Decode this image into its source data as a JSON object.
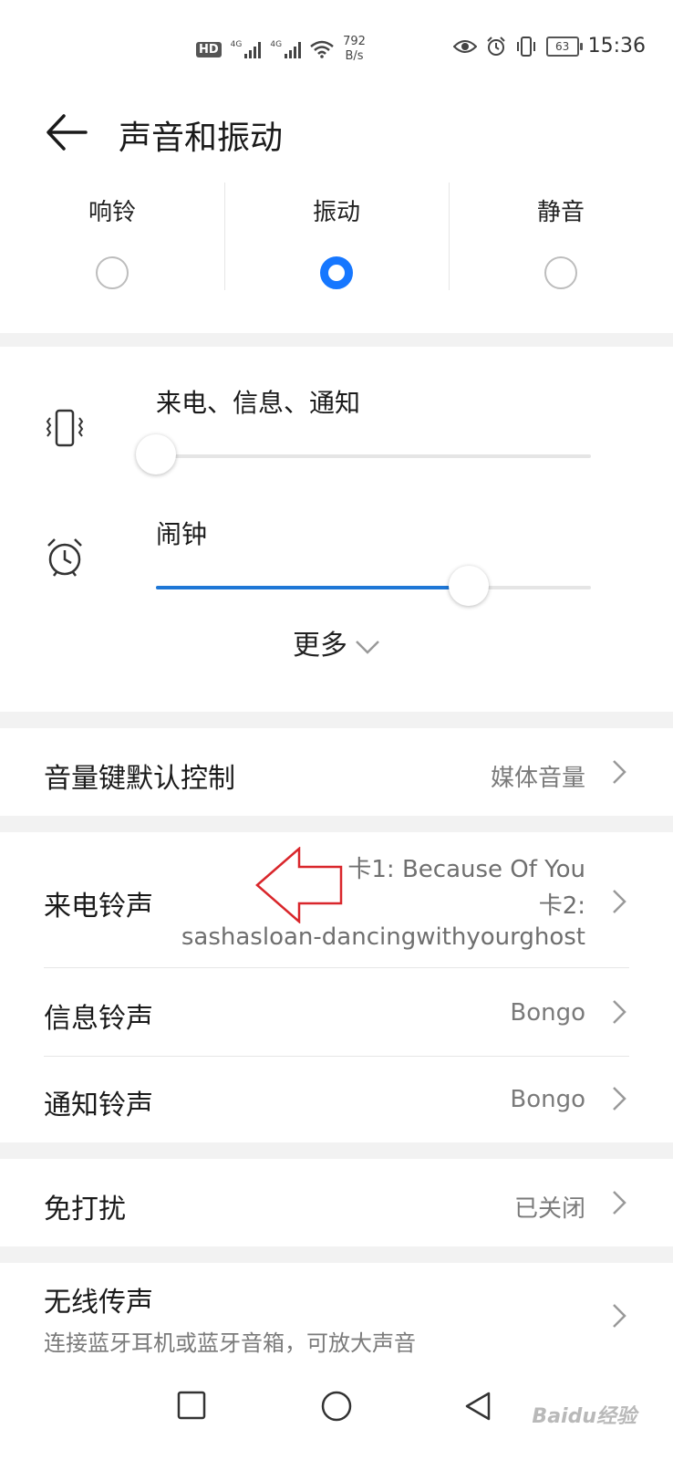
{
  "status_bar": {
    "hd": "HD",
    "sim1_net": "4G",
    "sim2_net": "4G",
    "speed_value": "792",
    "speed_unit": "B/s",
    "battery": "63",
    "time": "15:36"
  },
  "header": {
    "title": "声音和振动"
  },
  "modes": {
    "options": [
      {
        "label": "响铃",
        "selected": false
      },
      {
        "label": "振动",
        "selected": true
      },
      {
        "label": "静音",
        "selected": false
      }
    ]
  },
  "volume": {
    "calls": {
      "label": "来电、信息、通知",
      "level": 0.0
    },
    "alarm": {
      "label": "闹钟",
      "level": 0.72
    },
    "more_label": "更多"
  },
  "settings": {
    "volume_key": {
      "title": "音量键默认控制",
      "value": "媒体音量"
    },
    "ringtone": {
      "title": "来电铃声",
      "value_line1": "卡1: Because Of You",
      "value_line2": "卡2:",
      "value_line3": "sashasloan-dancingwithyourghost"
    },
    "message_tone": {
      "title": "信息铃声",
      "value": "Bongo"
    },
    "notification_tone": {
      "title": "通知铃声",
      "value": "Bongo"
    },
    "dnd": {
      "title": "免打扰",
      "value": "已关闭"
    },
    "wireless": {
      "title": "无线传声",
      "subtitle": "连接蓝牙耳机或蓝牙音箱，可放大声音"
    }
  },
  "watermark": "Baidu经验",
  "colors": {
    "accent": "#1677ff",
    "slider": "#1e77d6",
    "annotation_arrow": "#d9262b"
  }
}
